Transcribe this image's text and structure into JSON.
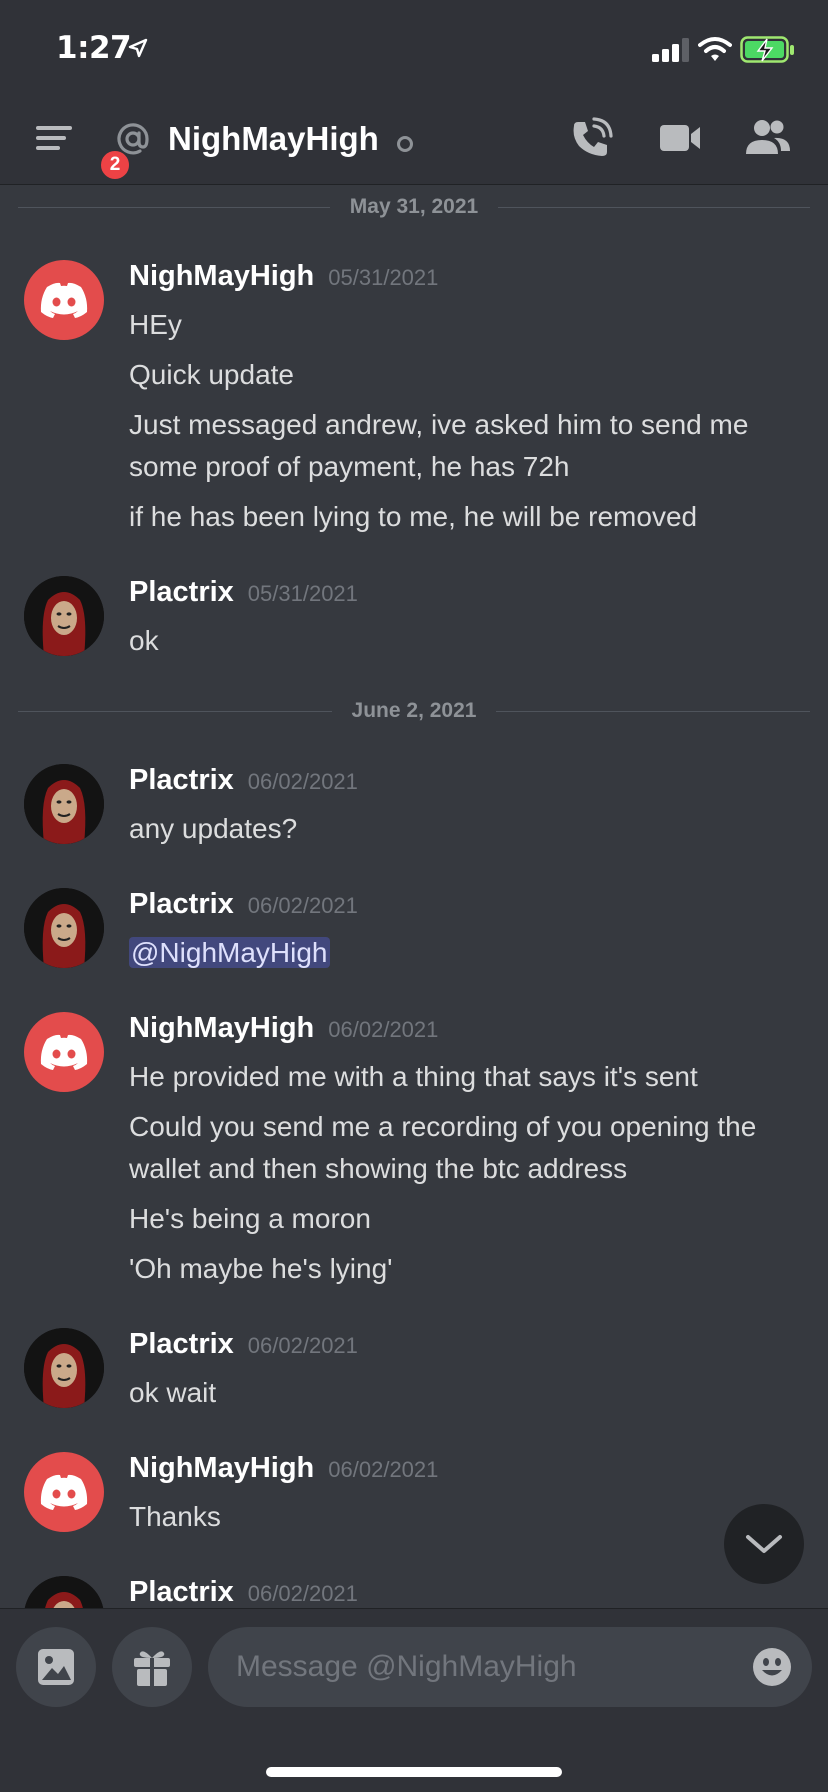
{
  "status_bar": {
    "time": "1:27",
    "icons": [
      "location-arrow-icon",
      "signal-icon",
      "wifi-icon",
      "battery-charging-icon"
    ]
  },
  "header": {
    "menu_badge": "2",
    "channel_name": "NighMayHigh",
    "icons": [
      "menu-icon",
      "at-icon",
      "call-icon",
      "video-icon",
      "members-icon"
    ]
  },
  "dividers": [
    {
      "label": "May 31, 2021"
    },
    {
      "label": "June 2, 2021"
    }
  ],
  "messages": [
    {
      "author": "NighMayHigh",
      "timestamp": "05/31/2021",
      "avatar": "discord-logo",
      "lines": [
        "HEy",
        "Quick update",
        "Just messaged andrew, ive asked him to send me some proof of payment, he has 72h",
        "if he has been lying to me, he will be removed"
      ]
    },
    {
      "author": "Plactrix",
      "timestamp": "05/31/2021",
      "avatar": "mask",
      "lines": [
        "ok"
      ]
    },
    {
      "author": "Plactrix",
      "timestamp": "06/02/2021",
      "avatar": "mask",
      "lines": [
        "any updates?"
      ]
    },
    {
      "author": "Plactrix",
      "timestamp": "06/02/2021",
      "avatar": "mask",
      "lines": [
        "@NighMayHigh"
      ]
    },
    {
      "author": "NighMayHigh",
      "timestamp": "06/02/2021",
      "avatar": "discord-logo",
      "lines": [
        "He provided me with a thing that says it's sent",
        "Could you send me a recording of you opening the wallet and then showing the btc address",
        "He's being a moron",
        "'Oh maybe he's lying'"
      ]
    },
    {
      "author": "Plactrix",
      "timestamp": "06/02/2021",
      "avatar": "mask",
      "lines": [
        "ok wait"
      ]
    },
    {
      "author": "NighMayHigh",
      "timestamp": "06/02/2021",
      "avatar": "discord-logo",
      "lines": [
        "Thanks"
      ]
    },
    {
      "author": "Plactrix",
      "timestamp": "06/02/2021",
      "avatar": "mask",
      "lines": []
    }
  ],
  "composer": {
    "placeholder": "Message @NighMayHigh"
  },
  "colors": {
    "background": "#36393f",
    "header": "#303238",
    "discord_red": "#e34c4c",
    "badge": "#ed4245",
    "mention_bg": "#4b5094"
  }
}
